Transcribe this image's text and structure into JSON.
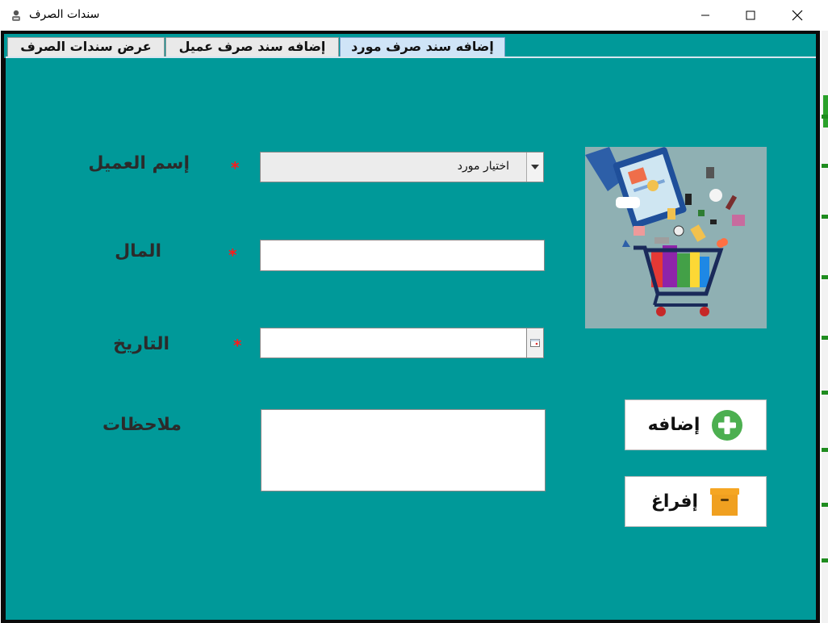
{
  "window": {
    "title": "سندات الصرف",
    "controls": [
      "minimize-icon",
      "maximize-icon",
      "close-icon"
    ]
  },
  "tabs": [
    {
      "label": "عرض سندات الصرف",
      "active": false
    },
    {
      "label": "إضافه سند صرف عميل",
      "active": false
    },
    {
      "label": "إضافه سند صرف مورد",
      "active": true
    }
  ],
  "form": {
    "customer_label": "إسم العميل",
    "customer_value": "اختيار مورد",
    "amount_label": "المال",
    "amount_value": "",
    "date_label": "التاريخ",
    "date_value": "",
    "notes_label": "ملاحظات",
    "notes_value": "",
    "required_marker": "*"
  },
  "buttons": {
    "add_label": "إضافه",
    "clear_label": "إفراغ"
  },
  "colors": {
    "panel": "#009999",
    "required": "#ff1a1a",
    "add_icon": "#4caf50",
    "clear_icon": "#f5a623"
  },
  "image": {
    "icon": "shopping-cart-illustration"
  }
}
